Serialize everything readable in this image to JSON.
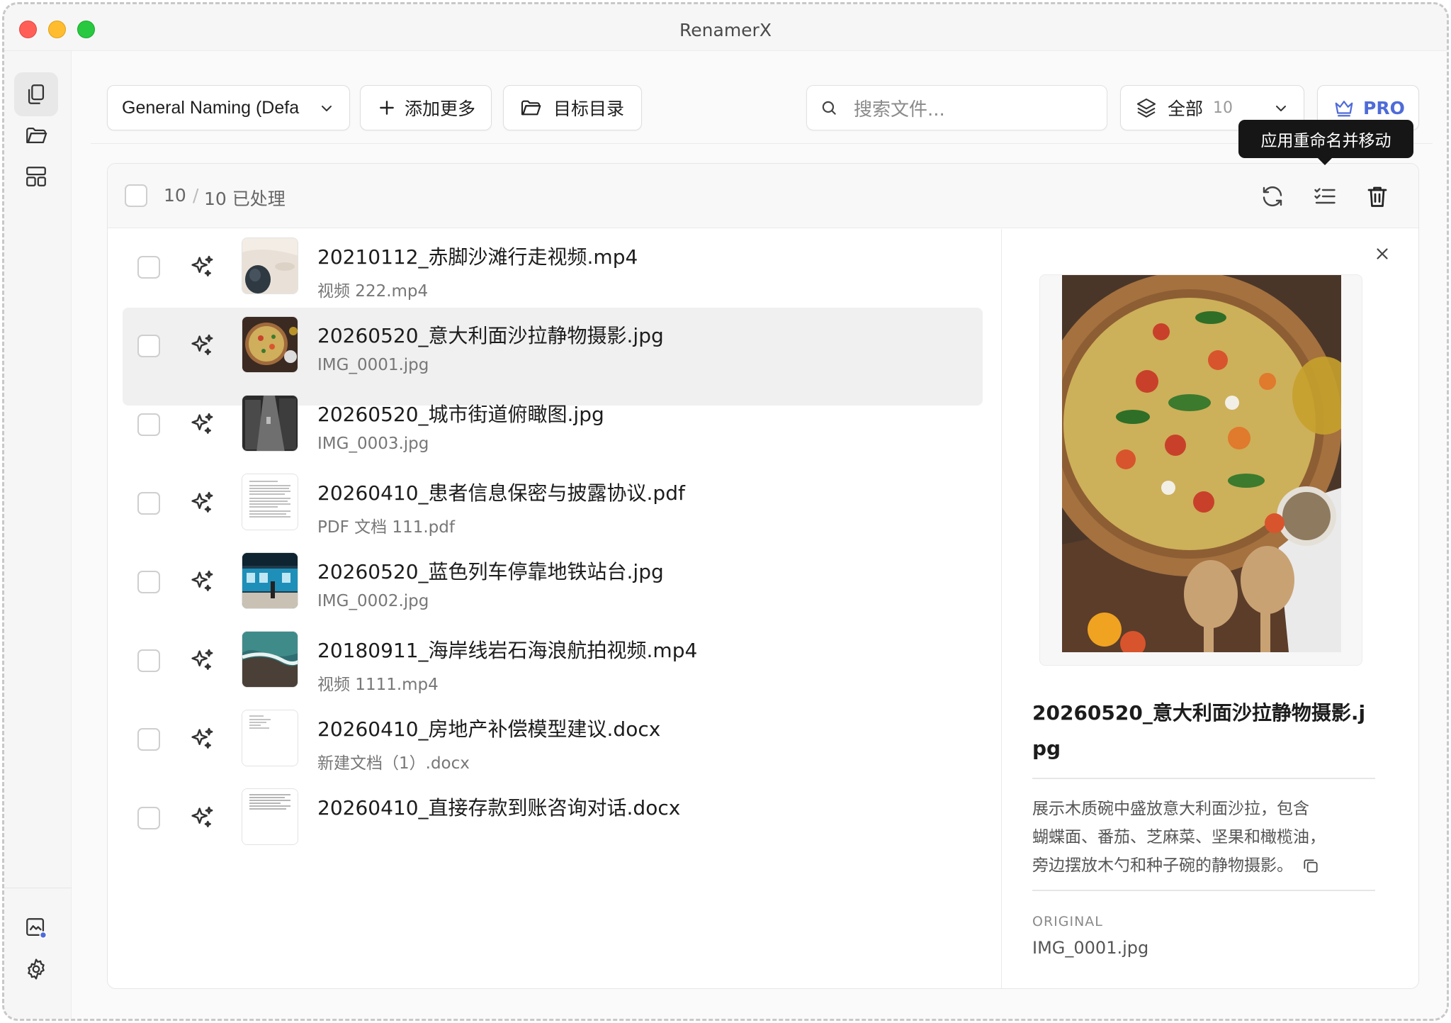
{
  "window": {
    "title": "RenamerX"
  },
  "toolbar": {
    "preset_label": "General Naming (Defa",
    "add_more_label": "添加更多",
    "target_dir_label": "目标目录",
    "search_placeholder": "搜索文件...",
    "filter_label": "全部",
    "filter_count": "10",
    "pro_label": "PRO"
  },
  "tooltip": {
    "text": "应用重命名并移动"
  },
  "list_header": {
    "count_done": "10",
    "separator": "/",
    "count_total_label": "10 已处理"
  },
  "files": [
    {
      "new_name": "20210112_赤脚沙滩行走视频.mp4",
      "original": "视频 222.mp4",
      "thumb": "beach"
    },
    {
      "new_name": "20260520_意大利面沙拉静物摄影.jpg",
      "original": "IMG_0001.jpg",
      "thumb": "salad",
      "selected": true
    },
    {
      "new_name": "20260520_城市街道俯瞰图.jpg",
      "original": "IMG_0003.jpg",
      "thumb": "street"
    },
    {
      "new_name": "20260410_患者信息保密与披露协议.pdf",
      "original": "PDF 文档 111.pdf",
      "thumb": "doc"
    },
    {
      "new_name": "20260520_蓝色列车停靠地铁站台.jpg",
      "original": "IMG_0002.jpg",
      "thumb": "train"
    },
    {
      "new_name": "20180911_海岸线岩石海浪航拍视频.mp4",
      "original": "视频 1111.mp4",
      "thumb": "coast"
    },
    {
      "new_name": "20260410_房地产补偿模型建议.docx",
      "original": "新建文档（1）.docx",
      "thumb": "doc2"
    },
    {
      "new_name": "20260410_直接存款到账咨询对话.docx",
      "original": "",
      "thumb": "doc3"
    }
  ],
  "detail": {
    "title": "20260520_意大利面沙拉静物摄影.jpg",
    "title_line1": "20260520_意大利面沙拉静物摄影.j",
    "title_line2": "pg",
    "description_line1": "展示木质碗中盛放意大利面沙拉，包含",
    "description_line2": "蝴蝶面、番茄、芝麻菜、坚果和橄榄油，",
    "description_line3": "旁边摆放木勺和种子碗的静物摄影。",
    "original_label": "ORIGINAL",
    "original_value": "IMG_0001.jpg"
  },
  "icons": {
    "sidebar": [
      "copy-icon",
      "folder-icon",
      "layout-icon",
      "image-sparkle-icon",
      "gear-icon"
    ],
    "toolbar": [
      "chevron-down-icon",
      "plus-icon",
      "folder-open-icon",
      "search-icon",
      "layers-icon",
      "crown-icon"
    ],
    "list_actions": [
      "refresh-icon",
      "checklist-icon",
      "trash-icon"
    ]
  },
  "colors": {
    "accent": "#4f6bd8",
    "tooltip_bg": "#161616",
    "selected_row": "#f0f0f0"
  }
}
